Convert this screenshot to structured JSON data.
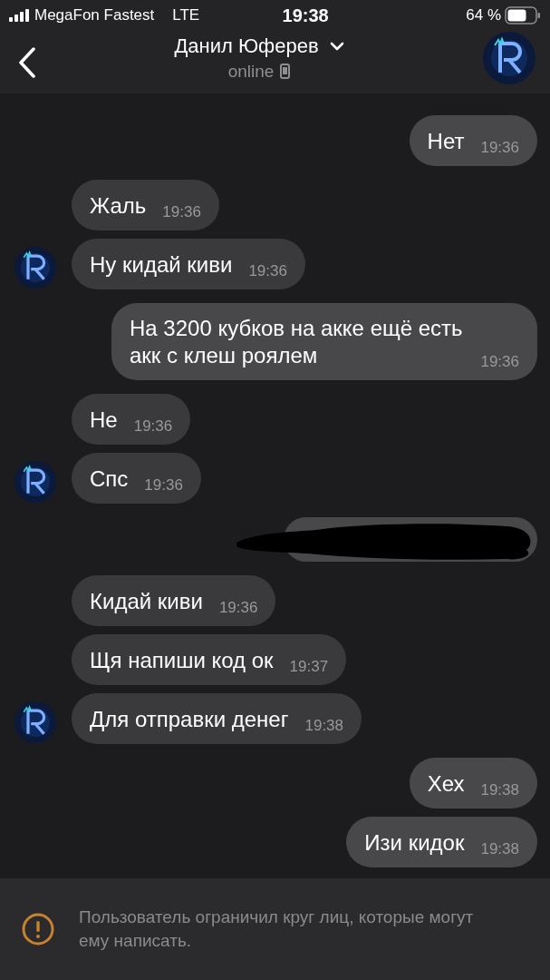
{
  "status_bar": {
    "carrier": "MegaFon Fastest",
    "network": "LTE",
    "time": "19:38",
    "battery": "64 %"
  },
  "header": {
    "title": "Данил Юферев",
    "subtitle": "online"
  },
  "messages": [
    {
      "outgoing": true,
      "kind": "text",
      "text": "Нет",
      "time": "19:36",
      "avatar": false
    },
    {
      "outgoing": false,
      "kind": "text",
      "text": "Жаль",
      "time": "19:36",
      "avatar": false
    },
    {
      "outgoing": false,
      "kind": "text",
      "text": "Ну кидай киви",
      "time": "19:36",
      "avatar": true
    },
    {
      "outgoing": true,
      "kind": "text",
      "text": "На 3200 кубков на акке ещё есть акк с клеш роялем",
      "time": "19:36",
      "avatar": false
    },
    {
      "outgoing": false,
      "kind": "text",
      "text": "Не",
      "time": "19:36",
      "avatar": false
    },
    {
      "outgoing": false,
      "kind": "text",
      "text": "Спс",
      "time": "19:36",
      "avatar": true
    },
    {
      "outgoing": true,
      "kind": "redacted",
      "avatar": false
    },
    {
      "outgoing": false,
      "kind": "text",
      "text": "Кидай киви",
      "time": "19:36",
      "avatar": false
    },
    {
      "outgoing": false,
      "kind": "text",
      "text": "Щя напиши код ок",
      "time": "19:37",
      "avatar": false
    },
    {
      "outgoing": false,
      "kind": "text",
      "text": "Для отправки денег",
      "time": "19:38",
      "avatar": true
    },
    {
      "outgoing": true,
      "kind": "text",
      "text": "Хех",
      "time": "19:38",
      "avatar": false
    },
    {
      "outgoing": true,
      "kind": "text",
      "text": "Изи кидок",
      "time": "19:38",
      "avatar": false
    }
  ],
  "notice": {
    "text": "Пользователь ограничил круг лиц, которые могут ему написать."
  }
}
